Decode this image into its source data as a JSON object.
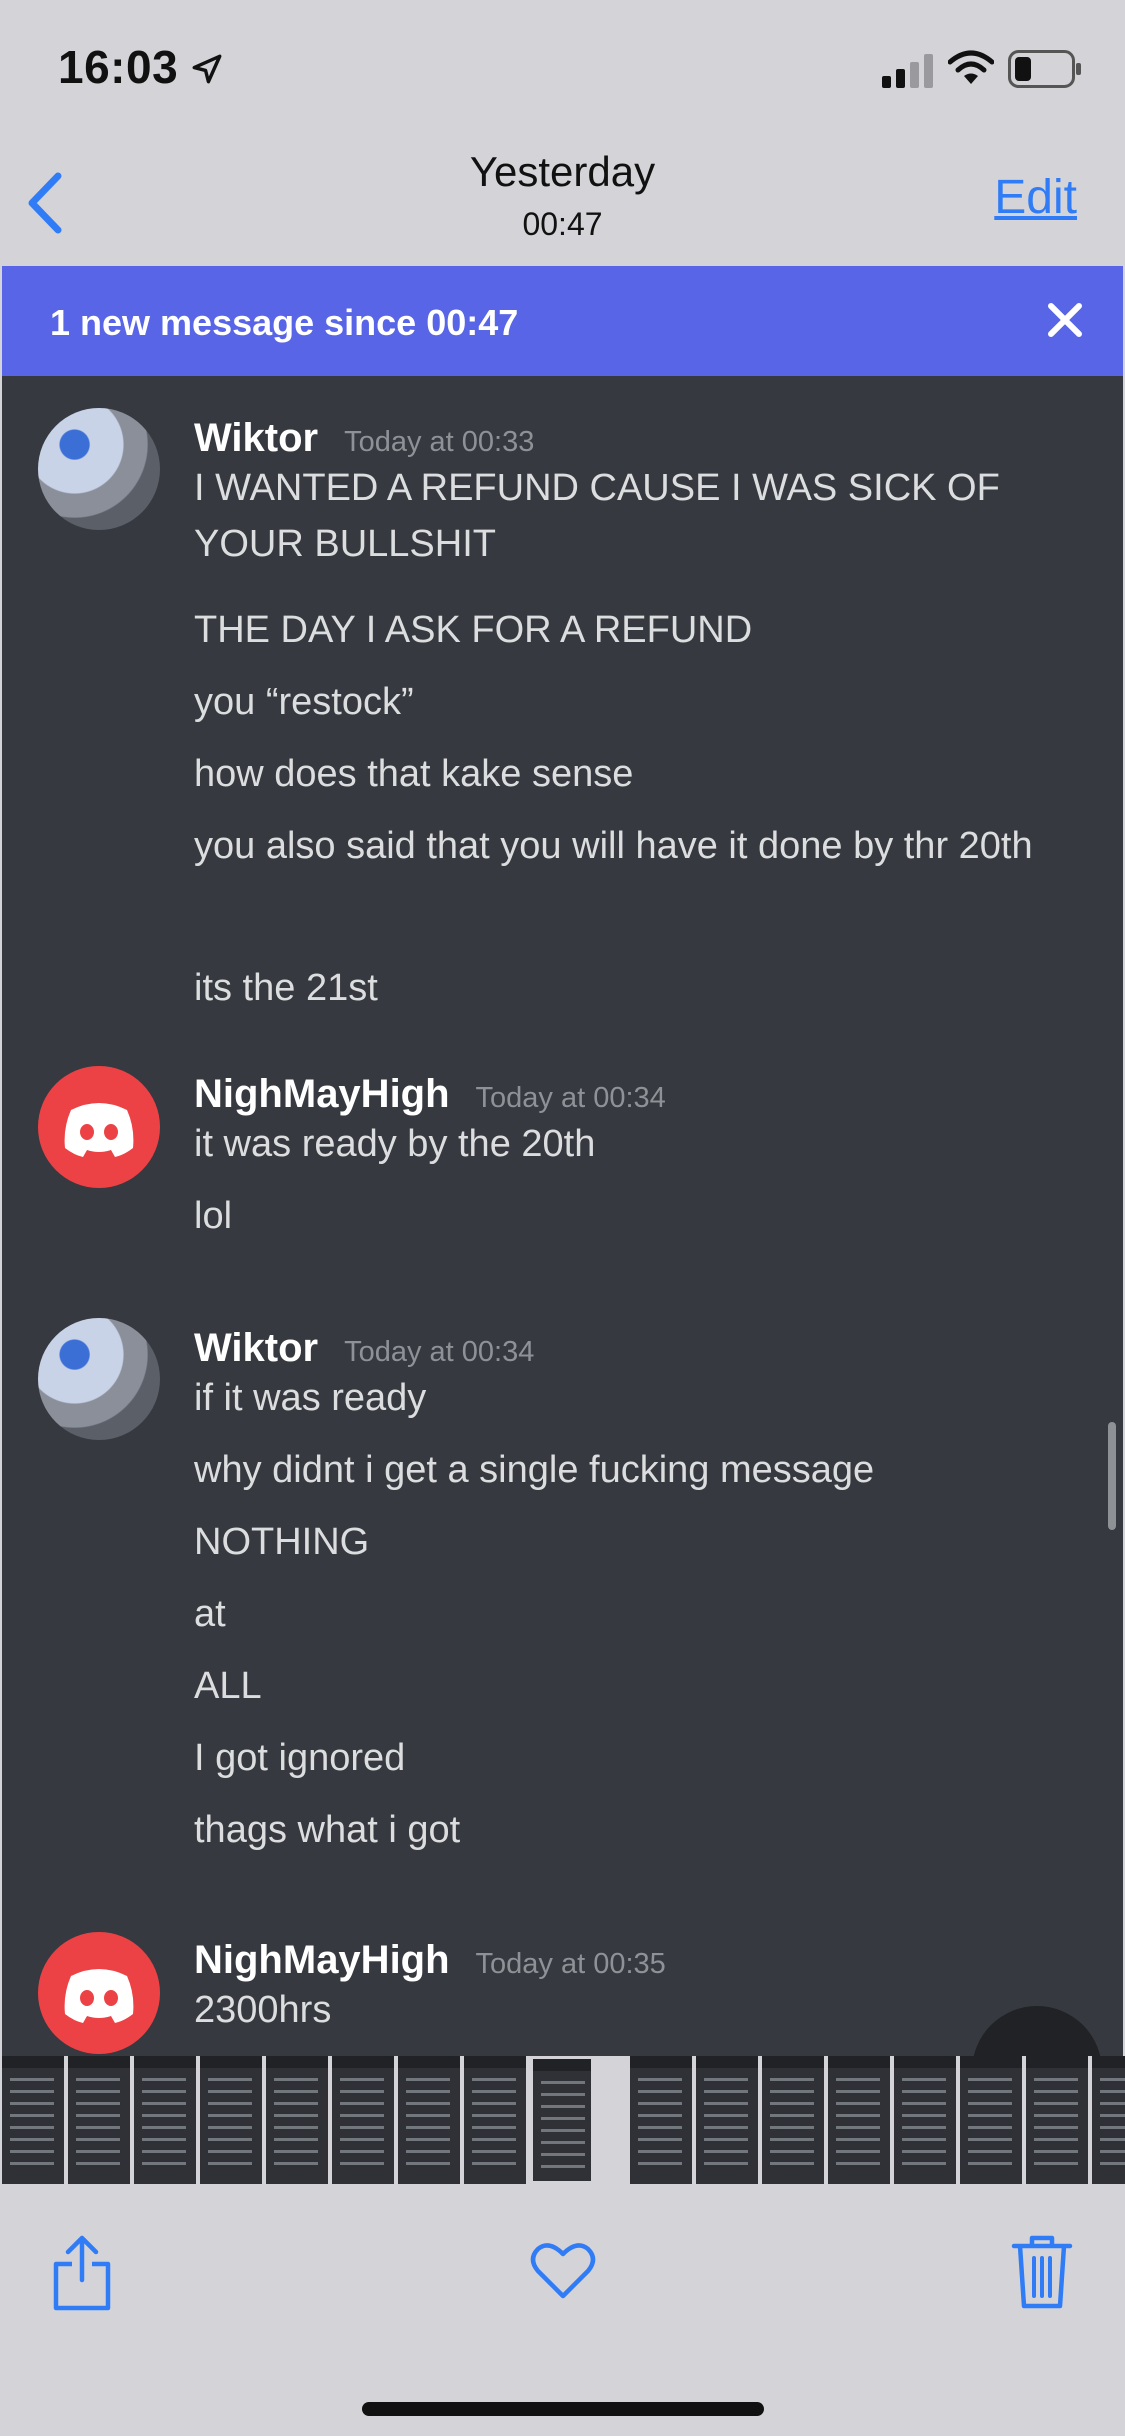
{
  "status_bar": {
    "time": "16:03"
  },
  "nav": {
    "title": "Yesterday",
    "subtitle": "00:47",
    "edit_label": "Edit"
  },
  "discord": {
    "banner_text": "1 new message since 00:47",
    "messages": [
      {
        "author": "Wiktor",
        "timestamp": "Today at 00:33",
        "avatar": "user-photo",
        "lines": [
          "I WANTED A REFUND CAUSE I WAS SICK OF YOUR BULLSHIT",
          "THE DAY I ASK FOR A REFUND",
          "you “restock”",
          "how does that kake sense",
          "you also said that you will have it done by thr 20th",
          "its the 21st"
        ]
      },
      {
        "author": "NighMayHigh",
        "timestamp": "Today at 00:34",
        "avatar": "discord-logo",
        "lines": [
          "it was ready by the 20th",
          "lol"
        ]
      },
      {
        "author": "Wiktor",
        "timestamp": "Today at 00:34",
        "avatar": "user-photo",
        "lines": [
          "if it was ready",
          "why didnt i get a single fucking message",
          "NOTHING",
          "at",
          "ALL",
          "I got ignored",
          "thags what i got"
        ]
      },
      {
        "author": "NighMayHigh",
        "timestamp": "Today at 00:35",
        "avatar": "discord-logo",
        "lines": [
          "2300hrs"
        ]
      }
    ]
  },
  "toolbar": {
    "share_icon": "share-icon",
    "favorite_icon": "heart-icon",
    "delete_icon": "trash-icon"
  },
  "colors": {
    "accent": "#2f7cf6",
    "discord_bg": "#36393f",
    "banner": "#5865e6",
    "discord_red": "#ed4245"
  }
}
